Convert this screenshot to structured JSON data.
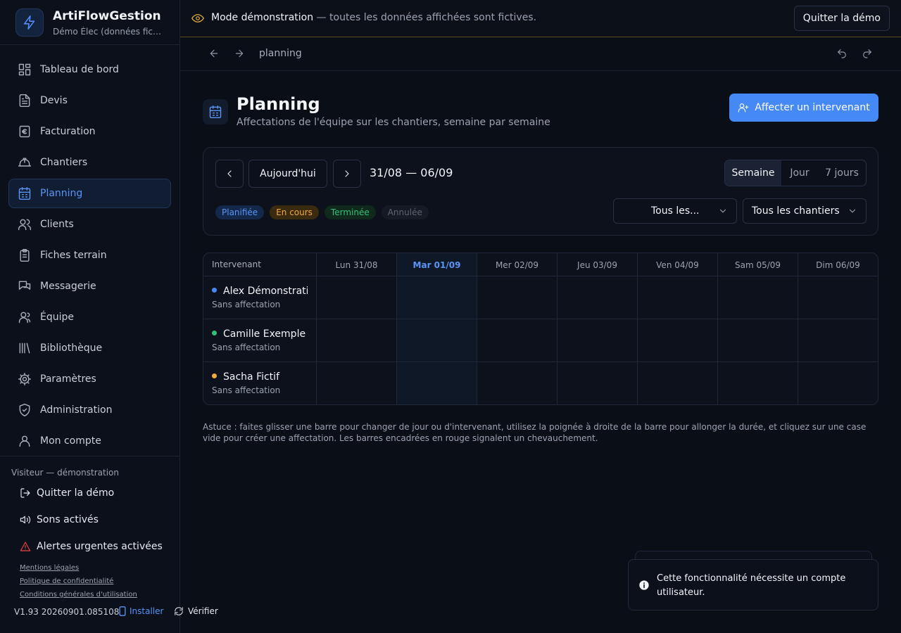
{
  "app": {
    "title": "ArtiFlowGestion",
    "subtitle": "Démo Élec (données fictives)"
  },
  "banner": {
    "title": "Mode démonstration",
    "text": " — toutes les données affichées sont fictives.",
    "quit_label": "Quitter la démo"
  },
  "history": {
    "breadcrumb": "planning"
  },
  "sidebar": {
    "items": [
      {
        "label": "Tableau de bord",
        "icon": "dashboard-icon"
      },
      {
        "label": "Devis",
        "icon": "document-icon"
      },
      {
        "label": "Facturation",
        "icon": "euro-icon"
      },
      {
        "label": "Chantiers",
        "icon": "hardhat-icon"
      },
      {
        "label": "Planning",
        "icon": "calendar-icon",
        "active": true
      },
      {
        "label": "Clients",
        "icon": "users-icon"
      },
      {
        "label": "Fiches terrain",
        "icon": "clipboard-icon"
      },
      {
        "label": "Messagerie",
        "icon": "messages-icon"
      },
      {
        "label": "Équipe",
        "icon": "team-icon"
      },
      {
        "label": "Bibliothèque",
        "icon": "library-icon"
      },
      {
        "label": "Paramètres",
        "icon": "gear-icon"
      },
      {
        "label": "Administration",
        "icon": "shield-icon"
      },
      {
        "label": "Mon compte",
        "icon": "user-icon"
      }
    ],
    "visitor": "Visiteur — démonstration",
    "quit_demo": "Quitter la démo",
    "sounds": "Sons activés",
    "alerts": "Alertes urgentes activées",
    "legal": [
      "Mentions légales",
      "Politique de confidentialité",
      "Conditions générales d'utilisation"
    ],
    "version": "V1.93 20260901.085108",
    "install": "Installer",
    "verify": "Vérifier"
  },
  "page": {
    "title": "Planning",
    "subtitle": "Affectations de l'équipe sur les chantiers, semaine par semaine",
    "assign_label": "Affecter un intervenant"
  },
  "toolbar": {
    "today_label": "Aujourd'hui",
    "range": "31/08 — 06/09",
    "views": [
      {
        "label": "Semaine",
        "active": true
      },
      {
        "label": "Jour"
      },
      {
        "label": "7 jours"
      }
    ],
    "statuses": [
      {
        "label": "Planifiée",
        "bg": "#13284a",
        "fg": "#5a95f5"
      },
      {
        "label": "En cours",
        "bg": "#3a2a0e",
        "fg": "#f2a93b"
      },
      {
        "label": "Terminée",
        "bg": "#0f2a1c",
        "fg": "#34c07a"
      },
      {
        "label": "Annulée",
        "bg": "#151a24",
        "fg": "#5d6575"
      }
    ],
    "filter_people": "Tous les...",
    "filter_sites": "Tous les chantiers"
  },
  "grid": {
    "header_first": "Intervenant",
    "days": [
      {
        "label": "Lun 31/08"
      },
      {
        "label": "Mar 01/09",
        "today": true
      },
      {
        "label": "Mer 02/09"
      },
      {
        "label": "Jeu 03/09"
      },
      {
        "label": "Ven 04/09"
      },
      {
        "label": "Sam 05/09"
      },
      {
        "label": "Dim 06/09"
      }
    ],
    "rows": [
      {
        "name": "Alex Démonstration",
        "status": "Sans affectation",
        "color": "#4589f6"
      },
      {
        "name": "Camille Exemple",
        "status": "Sans affectation",
        "color": "#34c07a"
      },
      {
        "name": "Sacha Fictif",
        "status": "Sans affectation",
        "color": "#f2a93b"
      }
    ]
  },
  "hint": "Astuce : faites glisser une barre pour changer de jour ou d'intervenant, utilisez la poignée à droite de la barre pour allonger la durée, et cliquez sur une case vide pour créer une affectation. Les barres encadrées en rouge signalent un chevauchement.",
  "toast": {
    "message": "Cette fonctionnalité nécessite un compte utilisateur."
  }
}
